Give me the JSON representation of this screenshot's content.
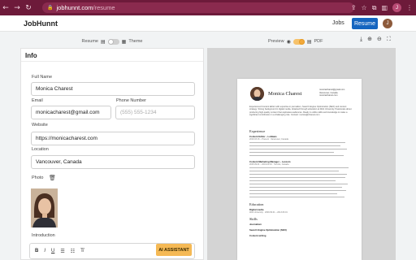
{
  "browser": {
    "url_host": "jobhunnt.com",
    "url_path": "/resume",
    "profile_initial": "J"
  },
  "app": {
    "brand": "JobHunnt",
    "nav": {
      "jobs": "Jobs",
      "resume": "Resume"
    },
    "user_initial": "J"
  },
  "editor_toolbar": {
    "resume_label": "Resume",
    "theme_label": "Theme"
  },
  "form": {
    "title": "Info",
    "full_name": {
      "label": "Full Name",
      "value": "Monica Charest"
    },
    "email": {
      "label": "Email",
      "value": "monicacharest@gmail.com"
    },
    "phone": {
      "label": "Phone Number",
      "placeholder": "(555) 555-1234"
    },
    "website": {
      "label": "Website",
      "value": "https://monicacharest.com"
    },
    "location": {
      "label": "Location",
      "value": "Vancouver, Canada"
    },
    "photo_label": "Photo",
    "introduction_label": "Introduction",
    "rte": {
      "bold": "B",
      "italic": "I",
      "underline": "U",
      "bullets": "☰",
      "numbered": "☷",
      "clear": "T̸"
    },
    "ai_button": "AI ASSISTANT"
  },
  "preview_toolbar": {
    "preview_label": "Preview",
    "pdf_label": "PDF"
  },
  "preview": {
    "name": "Monica Charest",
    "contact": [
      "monicacharest@gmail.com",
      "Vancouver, Canada",
      "monicacharest.com"
    ],
    "summary": "Experienced Content Editor with expertise in journalism, Search Engine Optimization (SEO) and content strategy. Strong background in digital media, obtained through education at Web University. Passionate about producing high-quality content that captivates audiences. Ready to utilize skills and knowledge to make a significant contribution in a challenging role. Contact: monica@charest.com",
    "experience_heading": "Experience",
    "job1_title": "Content Editor – Loblaws",
    "job1_meta": "2019.03.16 – Present · Vancouver, Canada",
    "job2_title": "Content Marketing Manager – Lexcom",
    "job2_meta": "2015.09.01 – 2019.02.16 · Toronto, Canada",
    "education_heading": "Education",
    "edu_school": "Digital media",
    "edu_meta": "Web University · 2009.09.01 – 2013.06.01",
    "skills_heading": "Skills",
    "skills": [
      "Journalism",
      "Search Engine Optimization (SEO)",
      "Content writing"
    ]
  }
}
